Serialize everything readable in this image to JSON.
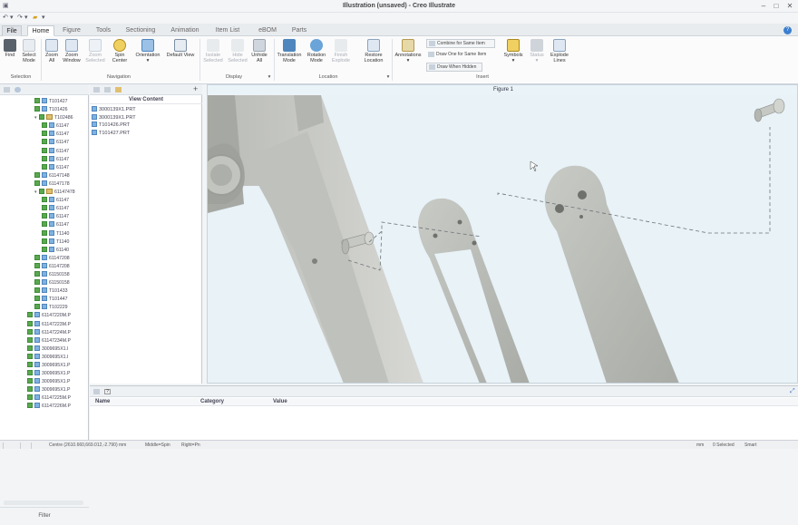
{
  "window": {
    "title": "Illustration (unsaved) - Creo Illustrate"
  },
  "menu": {
    "file_label": "File",
    "tabs": [
      "Home",
      "Figure",
      "Tools",
      "Sectioning",
      "Animation",
      "Item List",
      "eBOM",
      "Parts"
    ]
  },
  "ribbon": {
    "selection": {
      "group_label": "Selection",
      "find": "Find",
      "select_mode": [
        "Select",
        "Mode"
      ]
    },
    "navigation": {
      "group_label": "Navigation",
      "zoom_all": [
        "Zoom",
        "All"
      ],
      "zoom_window": [
        "Zoom",
        "Window"
      ],
      "zoom_selected": [
        "Zoom",
        "Selected"
      ],
      "spin_center": [
        "Spin",
        "Center"
      ],
      "orientation": "Orientation",
      "default_view": "Default View"
    },
    "display": {
      "group_label": "Display",
      "isolate_selected": [
        "Isolate",
        "Selected"
      ],
      "hide_selected": [
        "Hide",
        "Selected"
      ],
      "unhide_all": [
        "Unhide",
        "All"
      ]
    },
    "location": {
      "group_label": "Location",
      "translation_mode": [
        "Translation",
        "Mode"
      ],
      "rotation_mode": [
        "Rotation",
        "Mode"
      ],
      "finish_explode": [
        "Finish",
        "Explode"
      ],
      "restore_location": [
        "Restore",
        "Location"
      ]
    },
    "insert": {
      "group_label": "Insert",
      "annotations": "Annotations",
      "combine": "Combine for Same Item",
      "draw_one": "Draw One for Same Item",
      "draw_hidden": "Draw When Hidden",
      "symbols": "Symbols",
      "status": "Status",
      "explode_lines": [
        "Explode",
        "Lines"
      ]
    }
  },
  "structure_tree": {
    "rows": [
      {
        "indent": 1,
        "label": "T101427",
        "type": "part"
      },
      {
        "indent": 1,
        "label": "T101426",
        "type": "part"
      },
      {
        "indent": 1,
        "label": "T102486",
        "type": "asm",
        "toggle": "▾"
      },
      {
        "indent": 2,
        "label": "61147",
        "type": "part"
      },
      {
        "indent": 2,
        "label": "61147",
        "type": "part"
      },
      {
        "indent": 2,
        "label": "61147",
        "type": "part"
      },
      {
        "indent": 2,
        "label": "61147",
        "type": "part"
      },
      {
        "indent": 2,
        "label": "61147",
        "type": "part"
      },
      {
        "indent": 2,
        "label": "61147",
        "type": "part"
      },
      {
        "indent": 1,
        "label": "61147148",
        "type": "part"
      },
      {
        "indent": 1,
        "label": "61147178",
        "type": "part"
      },
      {
        "indent": 1,
        "label": "61147478",
        "type": "asm",
        "toggle": "▾"
      },
      {
        "indent": 2,
        "label": "61147",
        "type": "part"
      },
      {
        "indent": 2,
        "label": "61147",
        "type": "part"
      },
      {
        "indent": 2,
        "label": "61147",
        "type": "part"
      },
      {
        "indent": 2,
        "label": "61147",
        "type": "part"
      },
      {
        "indent": 2,
        "label": "T1140",
        "type": "part"
      },
      {
        "indent": 2,
        "label": "T1140",
        "type": "part"
      },
      {
        "indent": 2,
        "label": "61140",
        "type": "part"
      },
      {
        "indent": 1,
        "label": "61147208",
        "type": "part"
      },
      {
        "indent": 1,
        "label": "61147208",
        "type": "part"
      },
      {
        "indent": 1,
        "label": "61150158",
        "type": "part"
      },
      {
        "indent": 1,
        "label": "61150158",
        "type": "part"
      },
      {
        "indent": 1,
        "label": "T101433",
        "type": "part"
      },
      {
        "indent": 1,
        "label": "T101447",
        "type": "part"
      },
      {
        "indent": 1,
        "label": "T102229",
        "type": "part"
      },
      {
        "indent": 0,
        "label": "61147220M.P",
        "type": "part"
      },
      {
        "indent": 0,
        "label": "61147223M.P",
        "type": "part"
      },
      {
        "indent": 0,
        "label": "61147224M.P",
        "type": "part"
      },
      {
        "indent": 0,
        "label": "61147234M.P",
        "type": "part"
      },
      {
        "indent": 0,
        "label": "3009695X1.I",
        "type": "part"
      },
      {
        "indent": 0,
        "label": "3009695X1.I",
        "type": "part"
      },
      {
        "indent": 0,
        "label": "3009695X1.P",
        "type": "part"
      },
      {
        "indent": 0,
        "label": "3009695X1.P",
        "type": "part"
      },
      {
        "indent": 0,
        "label": "3009695X1.P",
        "type": "part"
      },
      {
        "indent": 0,
        "label": "3009695X1.P",
        "type": "part"
      },
      {
        "indent": 0,
        "label": "61147225M.P",
        "type": "part"
      },
      {
        "indent": 0,
        "label": "61147226M.P",
        "type": "part"
      }
    ],
    "filter_label": "Filter"
  },
  "view_content": {
    "header": "View Content",
    "items": [
      "3000139X1.PRT",
      "3000139X1.PRT",
      "T101426.PRT",
      "T101427.PRT"
    ]
  },
  "viewport": {
    "title": "Figure 1"
  },
  "properties": {
    "columns": [
      "Name",
      "Category",
      "Value"
    ]
  },
  "statusbar": {
    "centre": "Centre (2610.660,669.012,-2.790) mm",
    "mouse_mode": "Middle=Spin",
    "right_mode": "Right=Pn",
    "units": "mm",
    "selected": "0 Selected",
    "smart": "Smart"
  },
  "colors": {
    "accent": "#2f6fbf",
    "tab_active": "#ffffff",
    "viewport_bg": "#e8f2f7",
    "part_gray": "#c9cbc7"
  }
}
